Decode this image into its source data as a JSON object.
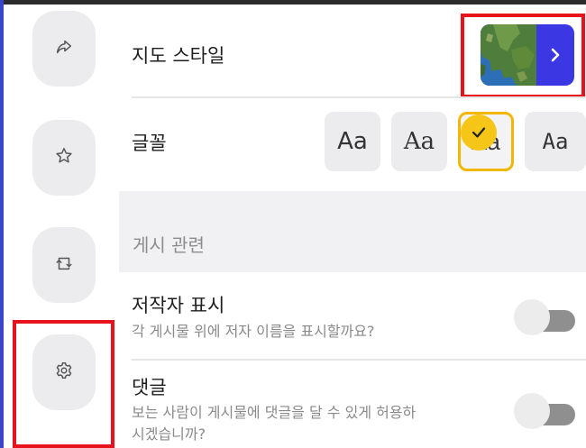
{
  "rail": {
    "share_label": "share",
    "favorite_label": "favorite",
    "repost_label": "repost",
    "settings_label": "settings"
  },
  "settings": {
    "map_style": {
      "label": "지도 스타일",
      "arrow": "›"
    },
    "font": {
      "label": "글꼴",
      "options": [
        {
          "sample": "Aa",
          "style": "sans"
        },
        {
          "sample": "Aa",
          "style": "serif"
        },
        {
          "sample": "Aa",
          "style": "rounded",
          "selected": true
        },
        {
          "sample": "Aa",
          "style": "mono"
        }
      ]
    },
    "section_header": "게시 관련",
    "show_author": {
      "title": "저작자 표시",
      "description": "각 게시물 위에 저자 이름을 표시할까요?",
      "enabled": false
    },
    "comments": {
      "title": "댓글",
      "description_line1": "보는 사람이 게시물에 댓글을 달 수 있게 허용하",
      "description_line2": "시겠습니까?",
      "enabled": false
    }
  },
  "colors": {
    "accent": "#3b38e3",
    "highlight": "#e8121c",
    "selection": "#f5c518"
  }
}
